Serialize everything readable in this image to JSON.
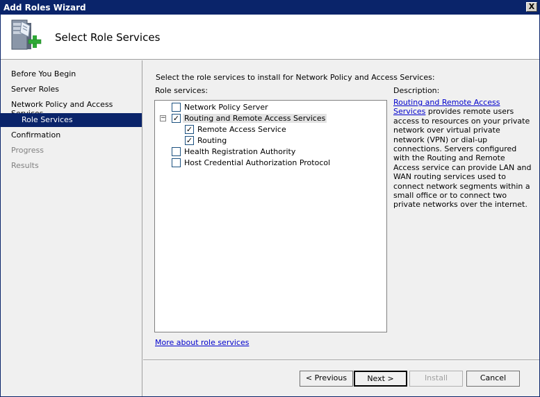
{
  "window": {
    "title": "Add Roles Wizard",
    "close_label": "X"
  },
  "header": {
    "title": "Select Role Services",
    "icon": "server-add-icon"
  },
  "sidebar": {
    "items": [
      {
        "label": "Before You Begin",
        "state": "normal"
      },
      {
        "label": "Server Roles",
        "state": "normal"
      },
      {
        "label": "Network Policy and Access Services",
        "state": "normal"
      },
      {
        "label": "Role Services",
        "state": "active"
      },
      {
        "label": "Confirmation",
        "state": "normal"
      },
      {
        "label": "Progress",
        "state": "disabled"
      },
      {
        "label": "Results",
        "state": "disabled"
      }
    ]
  },
  "main": {
    "instruction": "Select the role services to install for Network Policy and Access Services:",
    "role_services_label": "Role services:",
    "description_label": "Description:",
    "tree": [
      {
        "label": "Network Policy Server",
        "checked": false
      },
      {
        "label": "Routing and Remote Access Services",
        "checked": true,
        "expanded": true,
        "expander": "−"
      },
      {
        "label": "Remote Access Service",
        "checked": true
      },
      {
        "label": "Routing",
        "checked": true
      },
      {
        "label": "Health Registration Authority",
        "checked": false
      },
      {
        "label": "Host Credential Authorization Protocol",
        "checked": false
      }
    ],
    "description_link": "Routing and Remote Access Services",
    "description_text": " provides remote users access to resources on your private network over virtual private network (VPN) or dial-up connections. Servers configured with the Routing and Remote Access service can provide LAN and WAN routing services used to connect network segments within a small office or to connect two private networks over the internet.",
    "more_link": "More about role services"
  },
  "buttons": {
    "previous": "< Previous",
    "next": "Next >",
    "install": "Install",
    "cancel": "Cancel"
  },
  "colors": {
    "titlebar": "#0a246a",
    "selection": "#0a246a",
    "link": "#0000cc"
  }
}
